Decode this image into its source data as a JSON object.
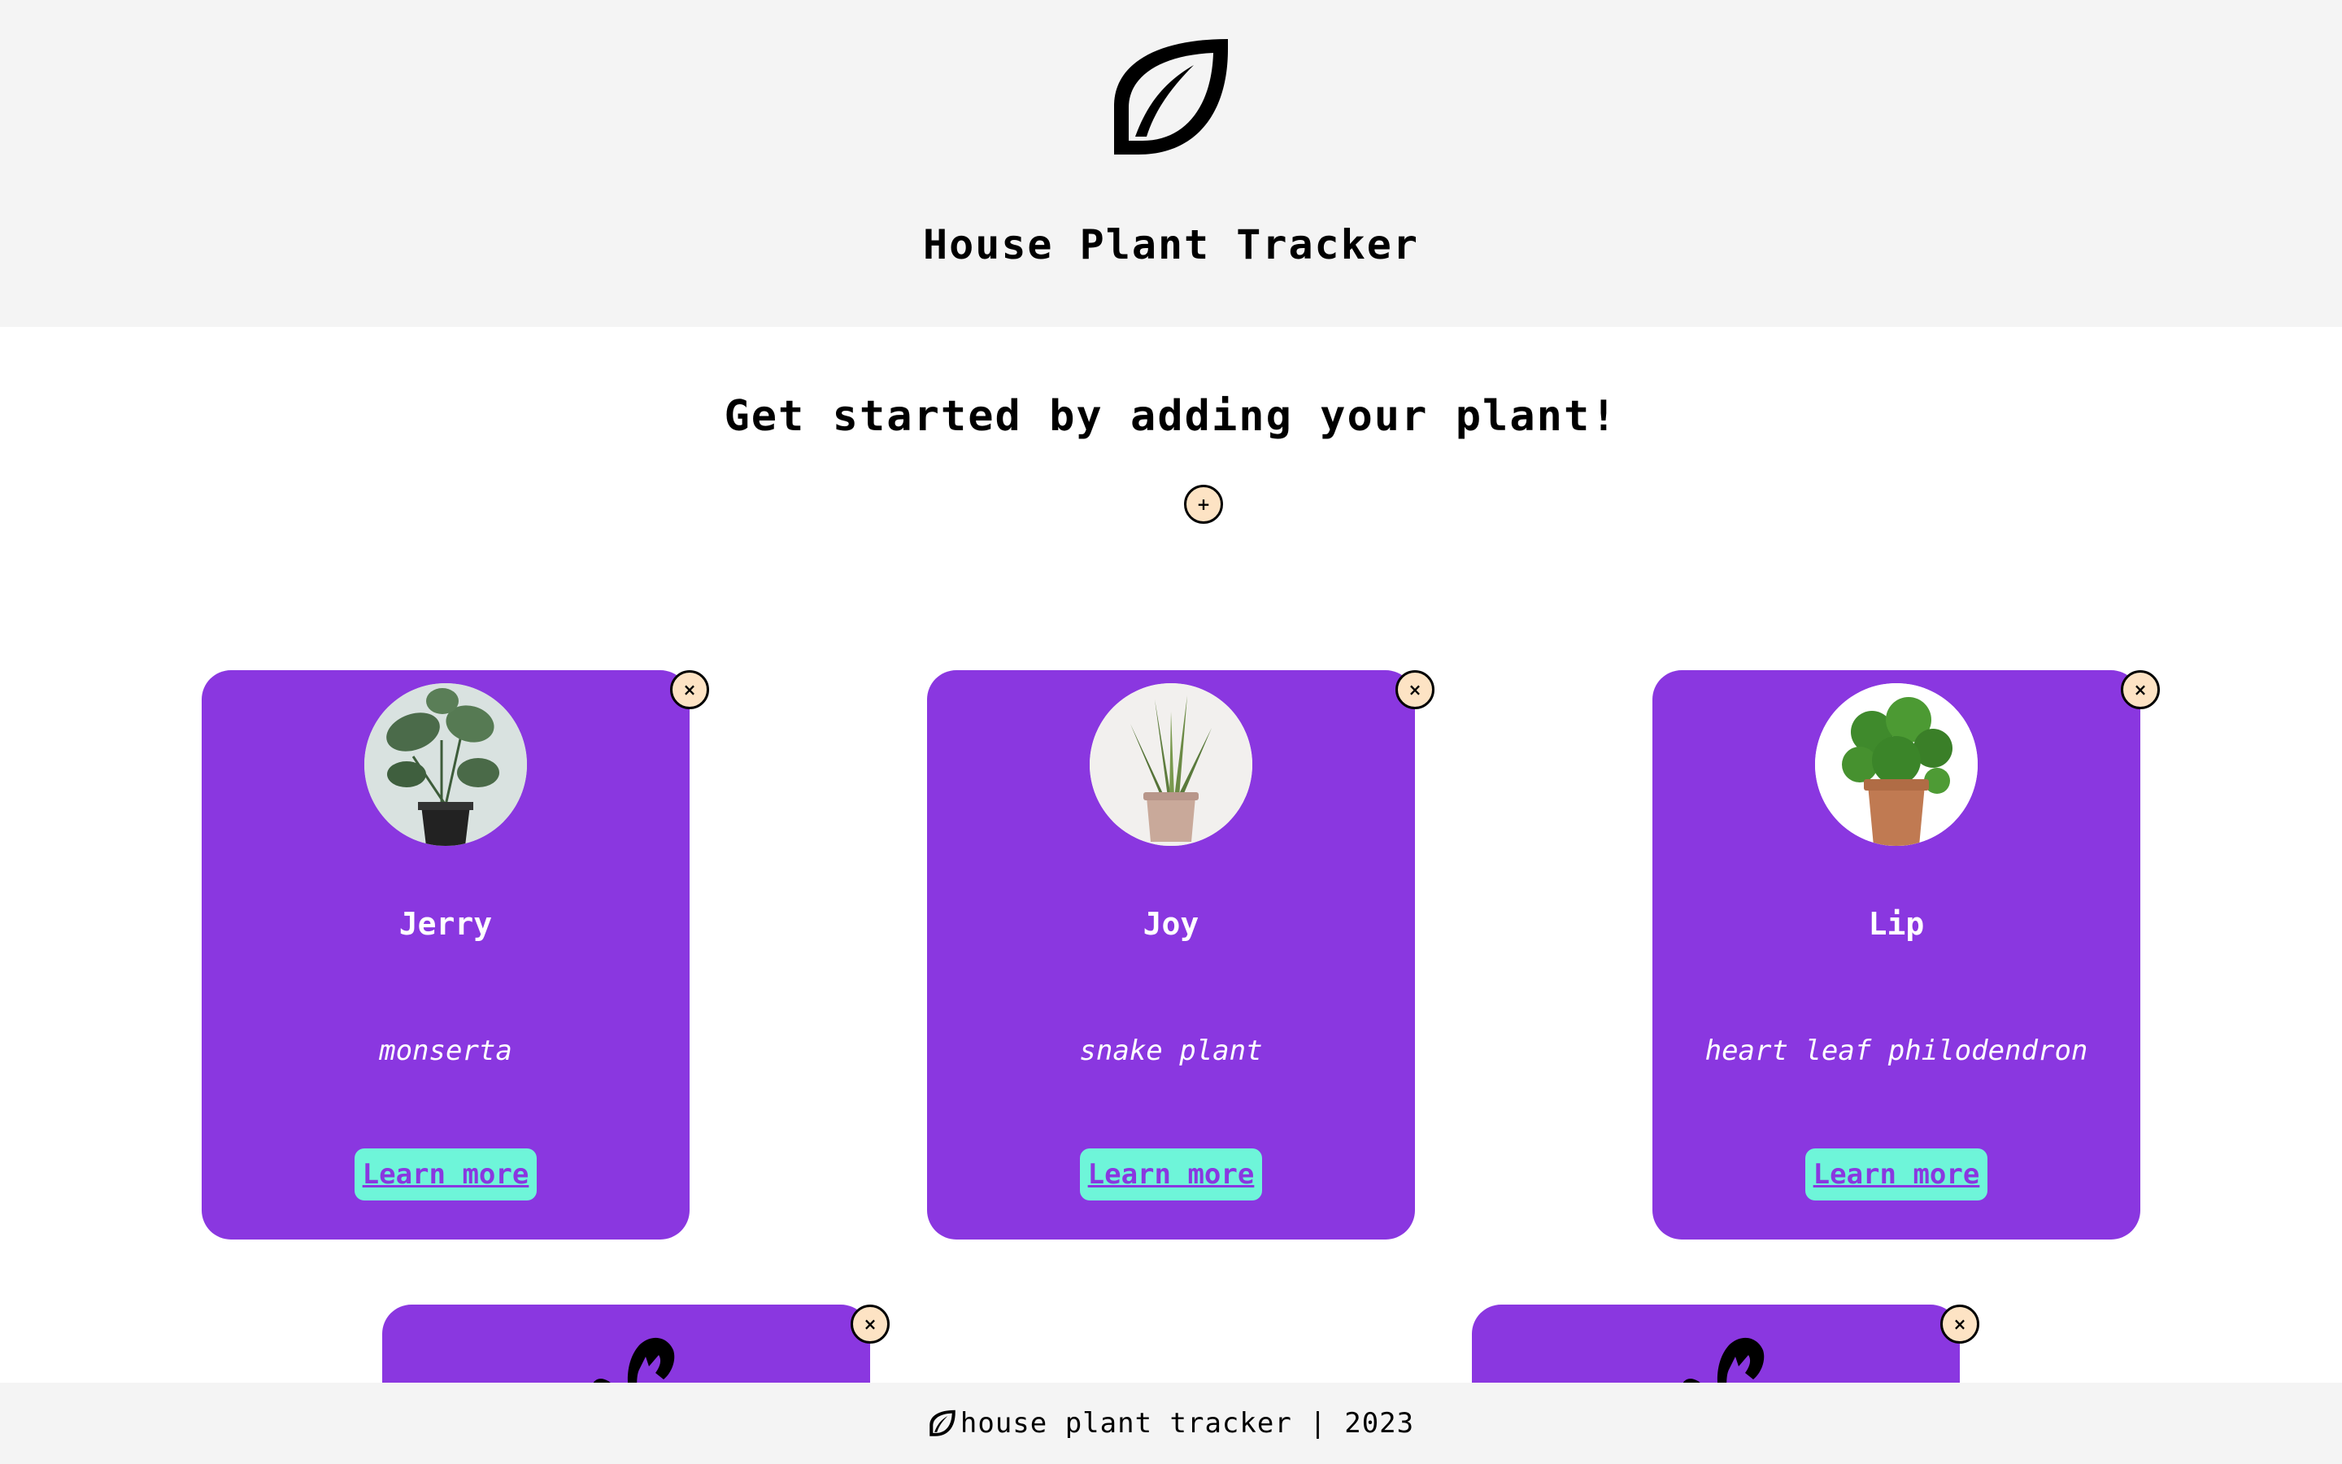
{
  "header": {
    "logo_icon": "leaf-icon",
    "title": "House Plant Tracker"
  },
  "main": {
    "prompt": "Get started by adding your plant!",
    "add_button_symbol": "+",
    "remove_button_symbol": "×",
    "cards": [
      {
        "name": "Jerry",
        "species": "monserta",
        "learn_more": "Learn more",
        "photo": "monstera-photo"
      },
      {
        "name": "Joy",
        "species": "snake plant",
        "learn_more": "Learn more",
        "photo": "snake-plant-photo"
      },
      {
        "name": "Lip",
        "species": "heart leaf philodendron",
        "learn_more": "Learn more",
        "photo": "philodendron-photo"
      },
      {
        "photo": "monstera-icon"
      },
      {
        "photo": "monstera-icon"
      }
    ]
  },
  "footer": {
    "icon": "leaf-icon",
    "text": "house plant tracker | 2023"
  },
  "colors": {
    "header_bg": "#f4f4f4",
    "card_bg": "#8a37e0",
    "learn_more_bg": "#6ef5d9",
    "round_button_bg": "#fde3c4"
  }
}
